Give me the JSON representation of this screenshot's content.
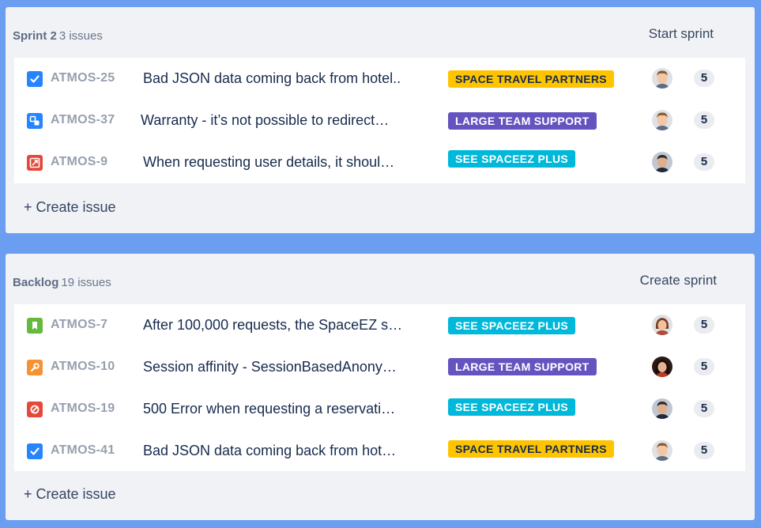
{
  "sprint": {
    "title": "Sprint 2",
    "count": "3 issues",
    "action_label": "Start sprint",
    "create_label": "+ Create issue",
    "issues": [
      {
        "type": "story-done",
        "key": "ATMOS-25",
        "summary": "Bad JSON data coming back from hotel..",
        "epic": "SPACE TRAVEL PARTNERS",
        "epic_color": "#ffc400",
        "epic_text_color": "#172b4d",
        "avatar": "man-light-brown-hair",
        "points": "5"
      },
      {
        "type": "subtask",
        "key": "ATMOS-37",
        "summary": "Warranty - it’s not possible to redirect…",
        "epic": "LARGE TEAM SUPPORT",
        "epic_color": "#6554c0",
        "epic_text_color": "#ffffff",
        "avatar": "man-light-brown-hair",
        "points": "5"
      },
      {
        "type": "improvement",
        "key": "ATMOS-9",
        "summary": "When requesting user details, it shoul…",
        "epic": "SEE SPACEEZ PLUS",
        "epic_color": "#00b8d9",
        "epic_text_color": "#ffffff",
        "avatar": "man-dark-hair",
        "points": "5"
      }
    ]
  },
  "backlog": {
    "title": "Backlog",
    "count": "19 issues",
    "action_label": "Create sprint",
    "create_label": "+ Create issue",
    "issues": [
      {
        "type": "story",
        "key": "ATMOS-7",
        "summary": "After 100,000 requests, the SpaceEZ s…",
        "epic": "SEE SPACEEZ PLUS",
        "epic_color": "#00b8d9",
        "epic_text_color": "#ffffff",
        "avatar": "woman-brown-hair",
        "points": "5"
      },
      {
        "type": "task",
        "key": "ATMOS-10",
        "summary": "Session affinity - SessionBasedAnony…",
        "epic": "LARGE TEAM SUPPORT",
        "epic_color": "#6554c0",
        "epic_text_color": "#ffffff",
        "avatar": "woman-dark-hair",
        "points": "5"
      },
      {
        "type": "bug",
        "key": "ATMOS-19",
        "summary": "500 Error when requesting a reservati…",
        "epic": "SEE SPACEEZ PLUS",
        "epic_color": "#00b8d9",
        "epic_text_color": "#ffffff",
        "avatar": "man-dark-hair",
        "points": "5"
      },
      {
        "type": "story-done",
        "key": "ATMOS-41",
        "summary": "Bad JSON data coming back from hot…",
        "epic": "SPACE TRAVEL PARTNERS",
        "epic_color": "#ffc400",
        "epic_text_color": "#172b4d",
        "avatar": "man-light-brown-hair",
        "points": "5"
      }
    ]
  },
  "colors": {
    "background": "#6b9ef0",
    "panel": "#f1f2f5",
    "done_icon": "#2684ff",
    "subtask_icon": "#2684ff",
    "improvement_icon": "#e5493a",
    "story_icon": "#63ba3c",
    "task_icon": "#f79232",
    "bug_icon": "#e5493a"
  }
}
